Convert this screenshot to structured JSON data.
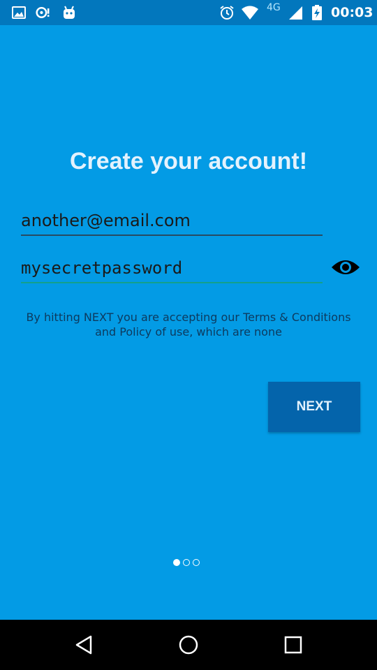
{
  "status_bar": {
    "network": "4G",
    "time": "00:03",
    "icons": [
      "image-icon",
      "sync-alert-icon",
      "android-icon",
      "alarm-icon",
      "wifi-icon",
      "signal-icon",
      "battery-charging-icon"
    ]
  },
  "signup": {
    "title": "Create your account!",
    "email_value": "another@email.com",
    "password_value": "mysecretpassword",
    "password_toggle_icon": "eye-icon",
    "terms_text": "By hitting NEXT you are accepting our Terms & Conditions and Policy of use, which are none",
    "next_label": "NEXT"
  },
  "pager": {
    "current_page": 1,
    "total_pages": 3
  },
  "nav_bar": {
    "icons": [
      "back-icon",
      "home-icon",
      "recents-icon"
    ]
  },
  "colors": {
    "background": "#039be5",
    "status_bar": "#0277bd",
    "button": "#0464ab",
    "focused_underline": "#14a08c"
  }
}
